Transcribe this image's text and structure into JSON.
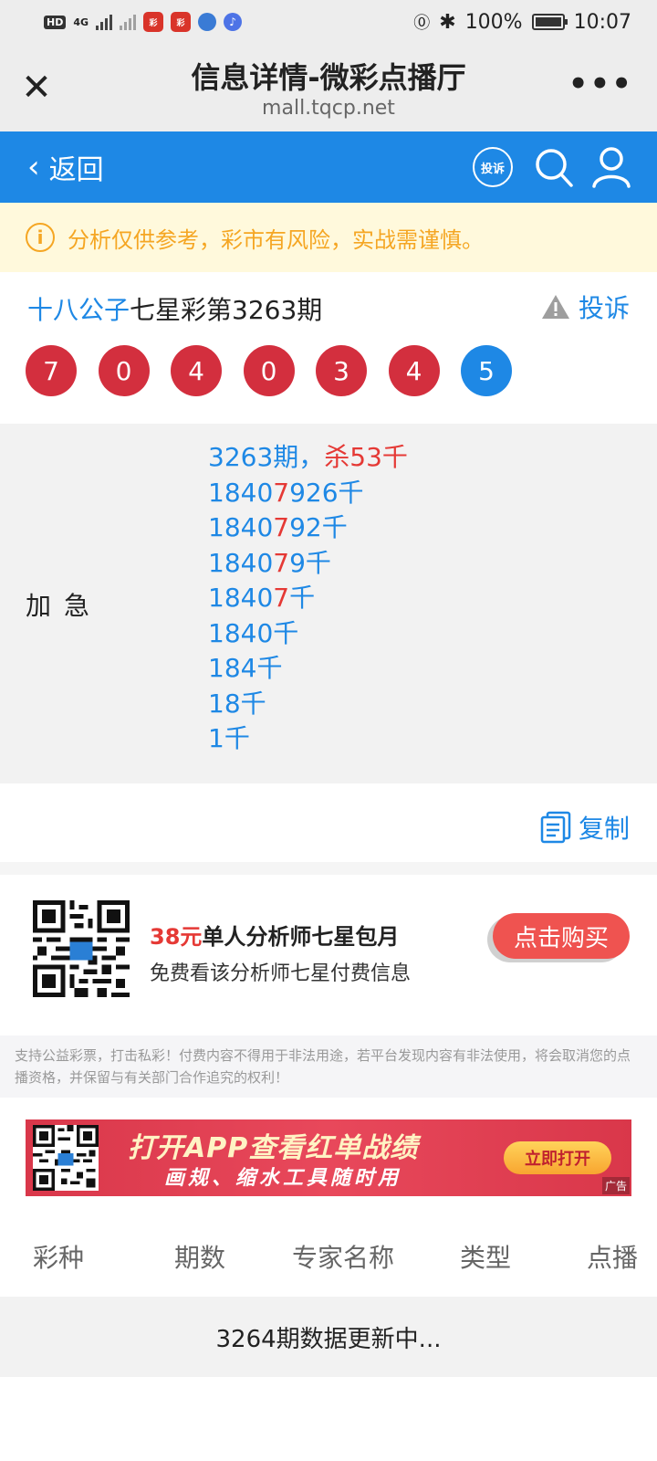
{
  "status_bar": {
    "network": "4G",
    "battery": "100%",
    "time": "10:07"
  },
  "browser": {
    "title": "信息详情-微彩点播厅",
    "url": "mall.tqcp.net",
    "close_icon": "close-icon",
    "more_icon": "more-dots-icon"
  },
  "nav": {
    "back_label": "返回",
    "complain_label": "投诉"
  },
  "notice": {
    "text": "分析仅供参考，彩市有风险，实战需谨慎。"
  },
  "info": {
    "expert": "十八公子",
    "lottery_issue": "七星彩第3263期",
    "report_label": "投诉",
    "balls": [
      {
        "num": "7",
        "color": "#d32f3e"
      },
      {
        "num": "0",
        "color": "#d32f3e"
      },
      {
        "num": "4",
        "color": "#d32f3e"
      },
      {
        "num": "0",
        "color": "#d32f3e"
      },
      {
        "num": "3",
        "color": "#d32f3e"
      },
      {
        "num": "4",
        "color": "#d32f3e"
      },
      {
        "num": "5",
        "color": "#1e88e5"
      }
    ]
  },
  "prediction": {
    "label": "加急",
    "header_issue": "3263期，",
    "header_kill": "杀53千",
    "lines": [
      {
        "pre": "1840",
        "hit": "7",
        "post": "926千"
      },
      {
        "pre": "1840",
        "hit": "7",
        "post": "92千"
      },
      {
        "pre": "1840",
        "hit": "7",
        "post": "9千"
      },
      {
        "pre": "1840",
        "hit": "7",
        "post": "千"
      },
      {
        "pre": "1840千",
        "hit": "",
        "post": ""
      },
      {
        "pre": "184千",
        "hit": "",
        "post": ""
      },
      {
        "pre": "18千",
        "hit": "",
        "post": ""
      },
      {
        "pre": "1千",
        "hit": "",
        "post": ""
      }
    ]
  },
  "copy_label": "复制",
  "promo": {
    "price": "38元",
    "title": "单人分析师七星包月",
    "subtitle": "免费看该分析师七星付费信息",
    "buy_label": "点击购买"
  },
  "disclaimer": "支持公益彩票，打击私彩！付费内容不得用于非法用途，若平台发现内容有非法使用，将会取消您的点播资格，并保留与有关部门合作追究的权利！",
  "banner": {
    "main": "打开APP查看红单战绩",
    "sub": "画规、缩水工具随时用",
    "button": "立即打开",
    "ad_tag": "广告"
  },
  "table": {
    "headers": [
      "彩种",
      "期数",
      "专家名称",
      "类型",
      "点播"
    ],
    "status": "3264期数据更新中..."
  },
  "colors": {
    "primary_blue": "#1e88e5",
    "ball_red": "#d32f3e",
    "notice_orange": "#f5a623",
    "highlight_red": "#e53935"
  }
}
